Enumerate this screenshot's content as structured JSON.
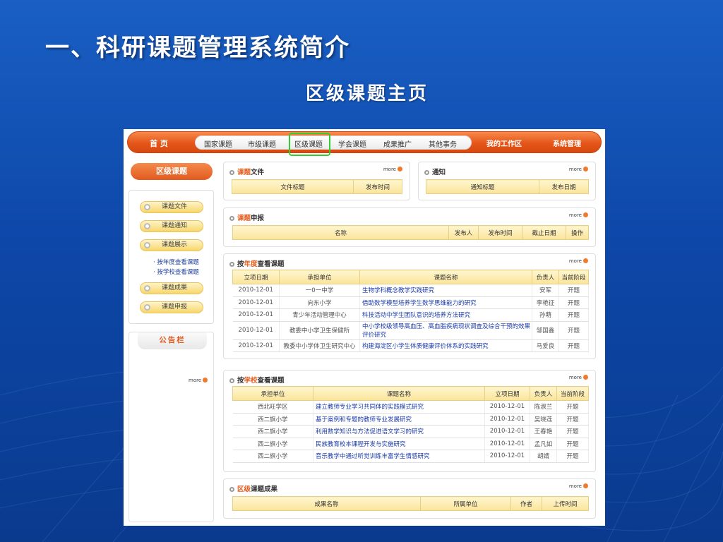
{
  "slide": {
    "title": "一、科研课题管理系统简介",
    "subtitle": "区级课题主页"
  },
  "nav": {
    "home": "首 页",
    "items": [
      "国家课题",
      "市级课题",
      "区级课题",
      "学会课题",
      "成果推广",
      "其他事务"
    ],
    "selected": "区级课题",
    "right": [
      "我的工作区",
      "系统管理"
    ]
  },
  "sidebar": {
    "header": "区级课题",
    "buttons": [
      "课题文件",
      "课题通知",
      "课题展示",
      "课题成果",
      "课题申报"
    ],
    "links": [
      "· 按年度查看课题",
      "· 按学校查看课题"
    ],
    "notice_tab": "公告栏",
    "notice_more": "more"
  },
  "files_panel": {
    "title_hl": "课题",
    "title_rest": "文件",
    "more": "more",
    "columns": [
      "文件标题",
      "发布时间"
    ]
  },
  "notice_panel": {
    "title_hl": "",
    "title_rest": "通知",
    "more": "more",
    "columns": [
      "通知标题",
      "发布日期"
    ]
  },
  "apply_panel": {
    "title_hl": "课题",
    "title_rest": "申报",
    "more": "more",
    "columns": [
      "名称",
      "发布人",
      "发布时间",
      "截止日期",
      "操作"
    ]
  },
  "year_panel": {
    "title_pre": "按",
    "title_hl": "年度",
    "title_rest": "查看课题",
    "more": "more",
    "columns": [
      "立项日期",
      "承担单位",
      "课题名称",
      "负责人",
      "当前阶段"
    ],
    "rows": [
      [
        "2010-12-01",
        "一0一中学",
        "生物学科概念教学实践研究",
        "安军",
        "开题"
      ],
      [
        "2010-12-01",
        "向东小学",
        "借助数学模型培养学生数学思维能力的研究",
        "李艳征",
        "开题"
      ],
      [
        "2010-12-01",
        "青少年活动管理中心",
        "科技活动中学生团队意识的培养方法研究",
        "孙萌",
        "开题"
      ],
      [
        "2010-12-01",
        "教委中小学卫生保健所",
        "中小学校级领导高血压、高血脂疾病现状调查及综合干预的效果评价研究",
        "邹国鑫",
        "开题"
      ],
      [
        "2010-12-01",
        "教委中小学体卫生研究中心",
        "构建海淀区小学生体质健康评价体系的实践研究",
        "马爱良",
        "开题"
      ]
    ]
  },
  "school_panel": {
    "title_pre": "按",
    "title_hl": "学校",
    "title_rest": "查看课题",
    "more": "more",
    "columns": [
      "承担单位",
      "课题名称",
      "立项日期",
      "负责人",
      "当前阶段"
    ],
    "rows": [
      [
        "西北旺学区",
        "建立教师专业学习共同体的实践模式研究",
        "2010-12-01",
        "陈淑兰",
        "开题"
      ],
      [
        "西二旗小学",
        "基于案例和专题的教师专业发展研究",
        "2010-12-01",
        "吴晓莲",
        "开题"
      ],
      [
        "西二旗小学",
        "利用数学知识与方法促进语文学习的研究",
        "2010-12-01",
        "王春艳",
        "开题"
      ],
      [
        "西二旗小学",
        "民族教育校本课程开发与实施研究",
        "2010-12-01",
        "孟凡如",
        "开题"
      ],
      [
        "西二旗小学",
        "音乐教学中通过听觉训练丰富学生情感研究",
        "2010-12-01",
        "胡婧",
        "开题"
      ]
    ]
  },
  "results_panel": {
    "title_hl": "区级",
    "title_rest": "课题成果",
    "more": "more",
    "columns": [
      "成果名称",
      "所属单位",
      "作者",
      "上传时间"
    ]
  },
  "colors": {
    "accent": "#e4561a",
    "highlight": "#33cc33",
    "slide_bg": "#0d47a8"
  }
}
